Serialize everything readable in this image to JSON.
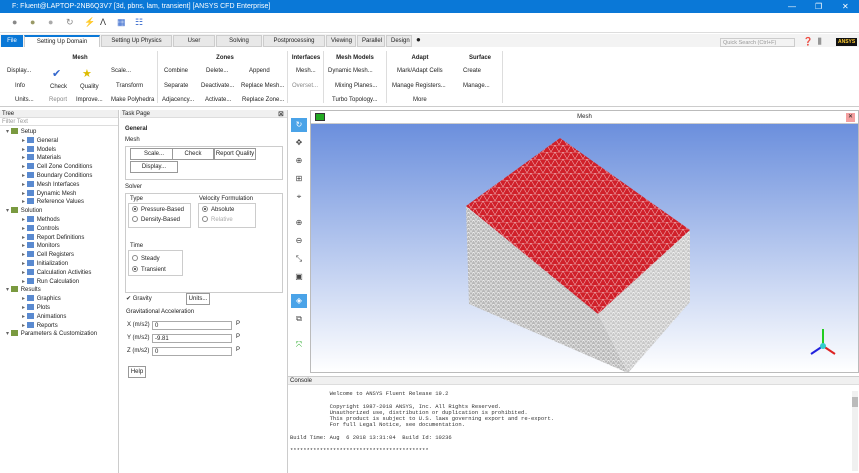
{
  "window": {
    "title": "F: Fluent@LAPTOP-2NB6Q3V7  [3d, pbns, lam, transient] [ANSYS CFD Enterprise]",
    "minimize": "—",
    "restore": "❐",
    "close": "✕"
  },
  "tabs": [
    {
      "label": "File"
    },
    {
      "label": "Setting Up Domain"
    },
    {
      "label": "Setting Up Physics"
    },
    {
      "label": "User Defined"
    },
    {
      "label": "Solving"
    },
    {
      "label": "Postprocessing"
    },
    {
      "label": "Viewing"
    },
    {
      "label": "Parallel"
    },
    {
      "label": "Design"
    }
  ],
  "search": {
    "placeholder": "Quick Search (Ctrl+F)"
  },
  "logo": "ANSYS",
  "ribbon": {
    "mesh": {
      "title": "Mesh",
      "display": "Display...",
      "info": "Info",
      "units": "Units...",
      "check": "Check",
      "report": "Report",
      "quality": "Quality",
      "improve": "Improve...",
      "scale": "Scale...",
      "transform": "Transform",
      "make_polyhedra": "Make Polyhedra"
    },
    "zones": {
      "title": "Zones",
      "combine": "Combine",
      "separate": "Separate",
      "adjacency": "Adjacency...",
      "delete": "Delete...",
      "deactivate": "Deactivate...",
      "activate": "Activate...",
      "append": "Append",
      "replace_mesh": "Replace Mesh...",
      "replace_zone": "Replace Zone..."
    },
    "interfaces": {
      "title": "Interfaces",
      "mesh": "Mesh...",
      "overset": "Overset..."
    },
    "mesh_models": {
      "title": "Mesh Models",
      "dynamic_mesh": "Dynamic Mesh...",
      "mixing_planes": "Mixing Planes...",
      "turbo_topology": "Turbo Topology..."
    },
    "adapt": {
      "title": "Adapt",
      "mark_adapt": "Mark/Adapt Cells",
      "manage": "Manage Registers...",
      "more": "More"
    },
    "surface": {
      "title": "Surface",
      "create": "Create",
      "manage": "Manage..."
    }
  },
  "tree": {
    "title": "Tree",
    "filter_placeholder": "Filter Text",
    "items": [
      {
        "label": "Setup",
        "level": 0
      },
      {
        "label": "General",
        "level": 1
      },
      {
        "label": "Models",
        "level": 1
      },
      {
        "label": "Materials",
        "level": 1
      },
      {
        "label": "Cell Zone Conditions",
        "level": 1
      },
      {
        "label": "Boundary Conditions",
        "level": 1
      },
      {
        "label": "Mesh Interfaces",
        "level": 1
      },
      {
        "label": "Dynamic Mesh",
        "level": 1
      },
      {
        "label": "Reference Values",
        "level": 1
      },
      {
        "label": "Solution",
        "level": 0
      },
      {
        "label": "Methods",
        "level": 1
      },
      {
        "label": "Controls",
        "level": 1
      },
      {
        "label": "Report Definitions",
        "level": 1
      },
      {
        "label": "Monitors",
        "level": 1
      },
      {
        "label": "Cell Registers",
        "level": 1
      },
      {
        "label": "Initialization",
        "level": 1
      },
      {
        "label": "Calculation Activities",
        "level": 1
      },
      {
        "label": "Run Calculation",
        "level": 1
      },
      {
        "label": "Results",
        "level": 0
      },
      {
        "label": "Graphics",
        "level": 1
      },
      {
        "label": "Plots",
        "level": 1
      },
      {
        "label": "Animations",
        "level": 1
      },
      {
        "label": "Reports",
        "level": 1
      },
      {
        "label": "Parameters & Customization",
        "level": 0
      }
    ]
  },
  "task": {
    "title": "Task Page",
    "heading": "General",
    "mesh_label": "Mesh",
    "scale": "Scale...",
    "check": "Check",
    "report_quality": "Report Quality",
    "display": "Display...",
    "solver": "Solver",
    "type": "Type",
    "pressure_based": "Pressure-Based",
    "density_based": "Density-Based",
    "velocity_formulation": "Velocity Formulation",
    "absolute": "Absolute",
    "relative": "Relative",
    "time": "Time",
    "steady": "Steady",
    "transient": "Transient",
    "gravity": "Gravity",
    "units": "Units...",
    "grav_accel": "Gravitational Acceleration",
    "x_label": "X (m/s2)",
    "x_value": "0",
    "y_label": "Y (m/s2)",
    "y_value": "-9.81",
    "z_label": "Z (m/s2)",
    "z_value": "0",
    "param_p": "P",
    "help": "Help"
  },
  "graphics": {
    "title": "Mesh",
    "face_color": "#d0202a"
  },
  "console": {
    "title": "Console",
    "lines": [
      "            Welcome to ANSYS Fluent Release 19.2",
      "",
      "            Copyright 1987-2018 ANSYS, Inc. All Rights Reserved.",
      "            Unauthorized use, distribution or duplication is prohibited.",
      "            This product is subject to U.S. laws governing export and re-export.",
      "            For full Legal Notice, see documentation.",
      "",
      "Build Time: Aug  6 2018 13:31:04  Build Id: 10236",
      "",
      "******************************************"
    ]
  }
}
